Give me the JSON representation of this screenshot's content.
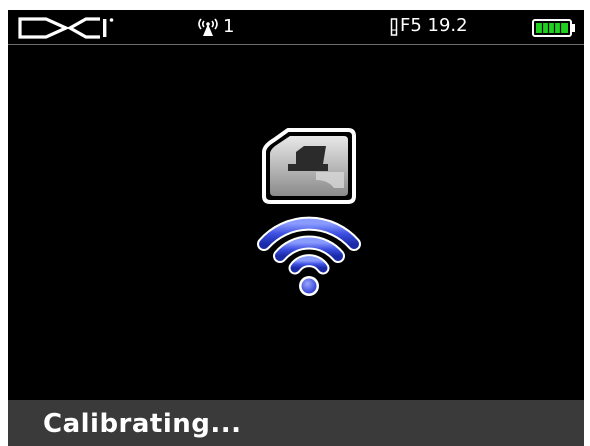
{
  "header": {
    "logo": "DCI",
    "signal_icon": "antenna-signal-icon",
    "signal_count": "1",
    "frequency_icon": "frequency-bar-icon",
    "frequency_label": "F5 19.2",
    "battery_icon": "battery-icon",
    "battery_level": 1.0,
    "battery_color": "#1fd11f"
  },
  "main": {
    "transmitter_icon": "transmitter-icon",
    "signal_waves_icon": "wifi-signal-icon",
    "wave_color": "#3d4fe0"
  },
  "status": {
    "message": "Calibrating..."
  }
}
